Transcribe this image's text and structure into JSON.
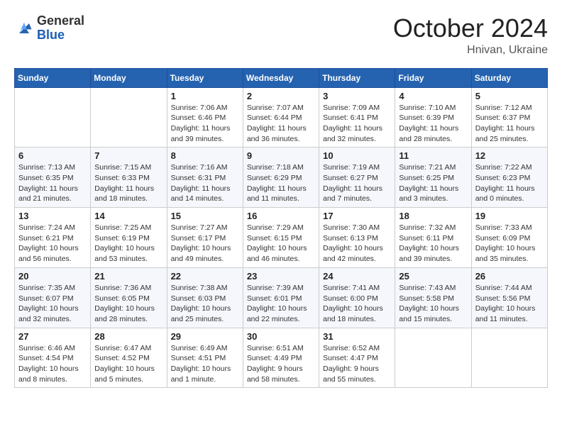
{
  "header": {
    "logo": {
      "general": "General",
      "blue": "Blue"
    },
    "month": "October 2024",
    "location": "Hnivan, Ukraine"
  },
  "weekdays": [
    "Sunday",
    "Monday",
    "Tuesday",
    "Wednesday",
    "Thursday",
    "Friday",
    "Saturday"
  ],
  "weeks": [
    [
      {
        "day": null
      },
      {
        "day": null
      },
      {
        "day": "1",
        "sunrise": "Sunrise: 7:06 AM",
        "sunset": "Sunset: 6:46 PM",
        "daylight": "Daylight: 11 hours and 39 minutes."
      },
      {
        "day": "2",
        "sunrise": "Sunrise: 7:07 AM",
        "sunset": "Sunset: 6:44 PM",
        "daylight": "Daylight: 11 hours and 36 minutes."
      },
      {
        "day": "3",
        "sunrise": "Sunrise: 7:09 AM",
        "sunset": "Sunset: 6:41 PM",
        "daylight": "Daylight: 11 hours and 32 minutes."
      },
      {
        "day": "4",
        "sunrise": "Sunrise: 7:10 AM",
        "sunset": "Sunset: 6:39 PM",
        "daylight": "Daylight: 11 hours and 28 minutes."
      },
      {
        "day": "5",
        "sunrise": "Sunrise: 7:12 AM",
        "sunset": "Sunset: 6:37 PM",
        "daylight": "Daylight: 11 hours and 25 minutes."
      }
    ],
    [
      {
        "day": "6",
        "sunrise": "Sunrise: 7:13 AM",
        "sunset": "Sunset: 6:35 PM",
        "daylight": "Daylight: 11 hours and 21 minutes."
      },
      {
        "day": "7",
        "sunrise": "Sunrise: 7:15 AM",
        "sunset": "Sunset: 6:33 PM",
        "daylight": "Daylight: 11 hours and 18 minutes."
      },
      {
        "day": "8",
        "sunrise": "Sunrise: 7:16 AM",
        "sunset": "Sunset: 6:31 PM",
        "daylight": "Daylight: 11 hours and 14 minutes."
      },
      {
        "day": "9",
        "sunrise": "Sunrise: 7:18 AM",
        "sunset": "Sunset: 6:29 PM",
        "daylight": "Daylight: 11 hours and 11 minutes."
      },
      {
        "day": "10",
        "sunrise": "Sunrise: 7:19 AM",
        "sunset": "Sunset: 6:27 PM",
        "daylight": "Daylight: 11 hours and 7 minutes."
      },
      {
        "day": "11",
        "sunrise": "Sunrise: 7:21 AM",
        "sunset": "Sunset: 6:25 PM",
        "daylight": "Daylight: 11 hours and 3 minutes."
      },
      {
        "day": "12",
        "sunrise": "Sunrise: 7:22 AM",
        "sunset": "Sunset: 6:23 PM",
        "daylight": "Daylight: 11 hours and 0 minutes."
      }
    ],
    [
      {
        "day": "13",
        "sunrise": "Sunrise: 7:24 AM",
        "sunset": "Sunset: 6:21 PM",
        "daylight": "Daylight: 10 hours and 56 minutes."
      },
      {
        "day": "14",
        "sunrise": "Sunrise: 7:25 AM",
        "sunset": "Sunset: 6:19 PM",
        "daylight": "Daylight: 10 hours and 53 minutes."
      },
      {
        "day": "15",
        "sunrise": "Sunrise: 7:27 AM",
        "sunset": "Sunset: 6:17 PM",
        "daylight": "Daylight: 10 hours and 49 minutes."
      },
      {
        "day": "16",
        "sunrise": "Sunrise: 7:29 AM",
        "sunset": "Sunset: 6:15 PM",
        "daylight": "Daylight: 10 hours and 46 minutes."
      },
      {
        "day": "17",
        "sunrise": "Sunrise: 7:30 AM",
        "sunset": "Sunset: 6:13 PM",
        "daylight": "Daylight: 10 hours and 42 minutes."
      },
      {
        "day": "18",
        "sunrise": "Sunrise: 7:32 AM",
        "sunset": "Sunset: 6:11 PM",
        "daylight": "Daylight: 10 hours and 39 minutes."
      },
      {
        "day": "19",
        "sunrise": "Sunrise: 7:33 AM",
        "sunset": "Sunset: 6:09 PM",
        "daylight": "Daylight: 10 hours and 35 minutes."
      }
    ],
    [
      {
        "day": "20",
        "sunrise": "Sunrise: 7:35 AM",
        "sunset": "Sunset: 6:07 PM",
        "daylight": "Daylight: 10 hours and 32 minutes."
      },
      {
        "day": "21",
        "sunrise": "Sunrise: 7:36 AM",
        "sunset": "Sunset: 6:05 PM",
        "daylight": "Daylight: 10 hours and 28 minutes."
      },
      {
        "day": "22",
        "sunrise": "Sunrise: 7:38 AM",
        "sunset": "Sunset: 6:03 PM",
        "daylight": "Daylight: 10 hours and 25 minutes."
      },
      {
        "day": "23",
        "sunrise": "Sunrise: 7:39 AM",
        "sunset": "Sunset: 6:01 PM",
        "daylight": "Daylight: 10 hours and 22 minutes."
      },
      {
        "day": "24",
        "sunrise": "Sunrise: 7:41 AM",
        "sunset": "Sunset: 6:00 PM",
        "daylight": "Daylight: 10 hours and 18 minutes."
      },
      {
        "day": "25",
        "sunrise": "Sunrise: 7:43 AM",
        "sunset": "Sunset: 5:58 PM",
        "daylight": "Daylight: 10 hours and 15 minutes."
      },
      {
        "day": "26",
        "sunrise": "Sunrise: 7:44 AM",
        "sunset": "Sunset: 5:56 PM",
        "daylight": "Daylight: 10 hours and 11 minutes."
      }
    ],
    [
      {
        "day": "27",
        "sunrise": "Sunrise: 6:46 AM",
        "sunset": "Sunset: 4:54 PM",
        "daylight": "Daylight: 10 hours and 8 minutes."
      },
      {
        "day": "28",
        "sunrise": "Sunrise: 6:47 AM",
        "sunset": "Sunset: 4:52 PM",
        "daylight": "Daylight: 10 hours and 5 minutes."
      },
      {
        "day": "29",
        "sunrise": "Sunrise: 6:49 AM",
        "sunset": "Sunset: 4:51 PM",
        "daylight": "Daylight: 10 hours and 1 minute."
      },
      {
        "day": "30",
        "sunrise": "Sunrise: 6:51 AM",
        "sunset": "Sunset: 4:49 PM",
        "daylight": "Daylight: 9 hours and 58 minutes."
      },
      {
        "day": "31",
        "sunrise": "Sunrise: 6:52 AM",
        "sunset": "Sunset: 4:47 PM",
        "daylight": "Daylight: 9 hours and 55 minutes."
      },
      {
        "day": null
      },
      {
        "day": null
      }
    ]
  ]
}
